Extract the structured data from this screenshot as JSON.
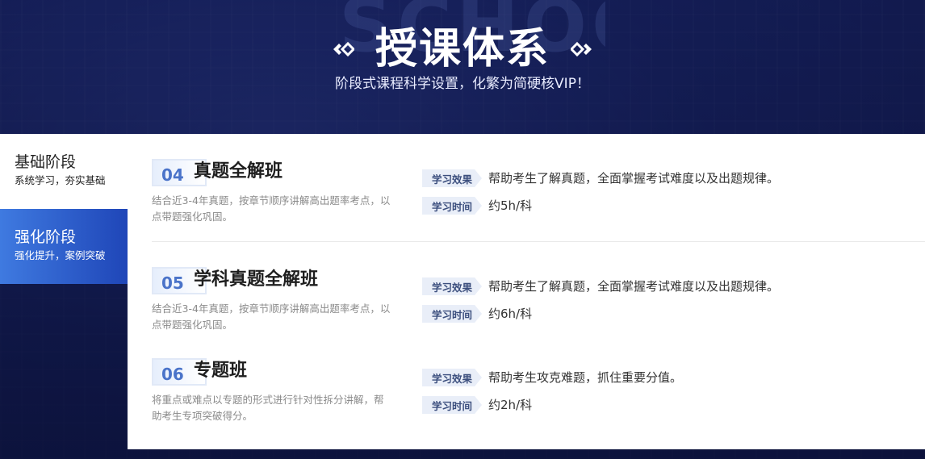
{
  "header": {
    "background_word": "SCHOOL",
    "title": "授课体系",
    "subtitle": "阶段式课程科学设置，化繁为简硬核VIP！"
  },
  "sidebar": {
    "items": [
      {
        "title": "基础阶段",
        "subtitle": "系统学习，夯实基础",
        "active": false
      },
      {
        "title": "强化阶段",
        "subtitle": "强化提升，案例突破",
        "active": true
      }
    ]
  },
  "courses": [
    {
      "number": "04",
      "name": "真题全解班",
      "description": "结合近3-4年真题，按章节顺序讲解高出题率考点，以点带题强化巩固。",
      "effect_label": "学习效果",
      "effect": "帮助考生了解真题，全面掌握考试难度以及出题规律。",
      "time_label": "学习时间",
      "time": "约5h/科"
    },
    {
      "number": "05",
      "name": "学科真题全解班",
      "description": "结合近3-4年真题，按章节顺序讲解高出题率考点，以点带题强化巩固。",
      "effect_label": "学习效果",
      "effect": "帮助考生了解真题，全面掌握考试难度以及出题规律。",
      "time_label": "学习时间",
      "time": "约6h/科"
    },
    {
      "number": "06",
      "name": "专题班",
      "description": "将重点或难点以专题的形式进行针对性拆分讲解，帮助考生专项突破得分。",
      "effect_label": "学习效果",
      "effect": "帮助考生攻克难题，抓住重要分值。",
      "time_label": "学习时间",
      "time": "约2h/科"
    }
  ],
  "colors": {
    "accent_blue": "#2f5fd0",
    "badge_text": "#4a73c9",
    "tag_bg": "#e9eef8"
  }
}
